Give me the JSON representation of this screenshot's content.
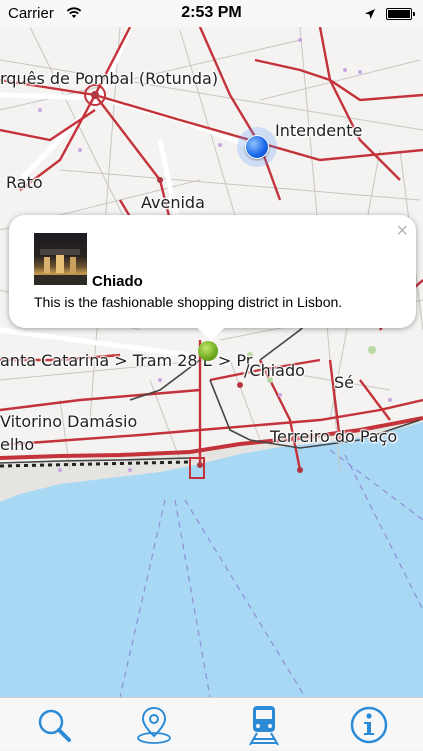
{
  "status_bar": {
    "carrier": "Carrier",
    "time": "2:53 PM",
    "wifi_icon": "wifi-icon",
    "location_icon": "location-arrow-icon",
    "battery_icon": "battery-icon"
  },
  "map": {
    "labels": {
      "pombal": "rquês de Pombal (Rotunda)",
      "intendente": "Intendente",
      "rato": "Rato",
      "avenida": "Avenida",
      "santa_catarina": "anta Catarina > Tram 28 E > Pr",
      "chiado": "/Chiado",
      "se": "Sé",
      "vitorino": "Vitorino Damásio",
      "terreiro": "Terreiro do Paço",
      "elho": "elho"
    },
    "colors": {
      "water": "#a9d8f5",
      "land": "#f4f3f1",
      "main_roads": "#c4323a",
      "rail": "#444444"
    }
  },
  "callout": {
    "title": "Chiado",
    "subtitle": "This is the fashionable shopping district in Lisbon.",
    "close_label": "×"
  },
  "tab_bar": {
    "tabs": [
      {
        "icon": "search-icon",
        "selected": false
      },
      {
        "icon": "map-pin-icon",
        "selected": false
      },
      {
        "icon": "train-icon",
        "selected": true
      },
      {
        "icon": "info-icon",
        "selected": false
      }
    ],
    "accent_color": "#2b8bd6"
  }
}
